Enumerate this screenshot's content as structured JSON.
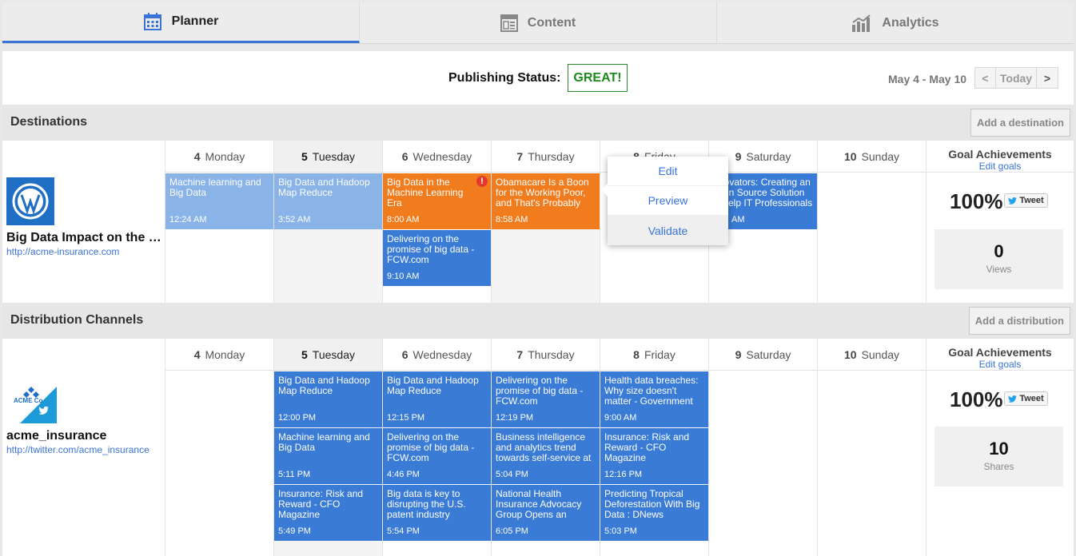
{
  "tabs": [
    {
      "label": "Planner",
      "icon": "calendar-icon"
    },
    {
      "label": "Content",
      "icon": "content-icon"
    },
    {
      "label": "Analytics",
      "icon": "analytics-icon"
    }
  ],
  "status": {
    "label": "Publishing Status:",
    "value": "GREAT!"
  },
  "date_nav": {
    "range": "May 4 - May 10",
    "prev": "<",
    "today": "Today",
    "next": ">"
  },
  "days": [
    {
      "num": "4",
      "name": "Monday"
    },
    {
      "num": "5",
      "name": "Tuesday"
    },
    {
      "num": "6",
      "name": "Wednesday"
    },
    {
      "num": "7",
      "name": "Thursday"
    },
    {
      "num": "8",
      "name": "Friday"
    },
    {
      "num": "9",
      "name": "Saturday"
    },
    {
      "num": "10",
      "name": "Sunday"
    }
  ],
  "goal": {
    "title": "Goal Achievements",
    "edit": "Edit goals"
  },
  "destinations": {
    "title": "Destinations",
    "add_label": "Add a destination",
    "name": "Big Data Impact on the In...",
    "url": "http://acme-insurance.com",
    "percent": "100%",
    "tweet": "Tweet",
    "metric_value": "0",
    "metric_label": "Views",
    "cards": [
      {
        "title": "Machine learning and Big Data",
        "time": "12:24 AM"
      },
      {
        "title": "Big Data and Hadoop Map Reduce",
        "time": "3:52 AM"
      },
      {
        "title": "Big Data in the Machine Learning Era",
        "time": "8:00 AM",
        "alert": "!"
      },
      {
        "title": "Delivering on the promise of big data - FCW.com",
        "time": "9:10 AM"
      },
      {
        "title": "Obamacare Is a Boon for the Working Poor, and That's Probably Good f...",
        "time": "8:58 AM"
      },
      {
        "title": "Innovators: Creating an Open Source Solution to Help IT Professionals ....",
        "time": "AM"
      }
    ]
  },
  "popup": {
    "edit": "Edit",
    "preview": "Preview",
    "validate": "Validate"
  },
  "distribution": {
    "title": "Distribution Channels",
    "add_label": "Add a distribution",
    "logo_text": "ACME Co",
    "name": "acme_insurance",
    "url": "http://twitter.com/acme_insurance",
    "percent": "100%",
    "tweet": "Tweet",
    "metric_value": "10",
    "metric_label": "Shares",
    "cards": [
      {
        "title": "Big Data and Hadoop Map Reduce",
        "time": "12:00 PM"
      },
      {
        "title": "Machine learning and Big Data",
        "time": "5:11 PM"
      },
      {
        "title": "Insurance: Risk and Reward - CFO Magazine",
        "time": "5:49 PM"
      },
      {
        "title": "Big Data and Hadoop Map Reduce",
        "time": "12:15 PM"
      },
      {
        "title": "Delivering on the promise of big data - FCW.com",
        "time": "4:46 PM"
      },
      {
        "title": "Big data is key to disrupting the U.S. patent industry",
        "time": "5:54 PM"
      },
      {
        "title": "Delivering on the promise of big data - FCW.com",
        "time": "12:19 PM"
      },
      {
        "title": "Business intelligence and analytics trend towards self-service at the Gartn...",
        "time": "5:04 PM"
      },
      {
        "title": "National Health Insurance Advocacy Group Opens an Innovation Lab in th...",
        "time": "6:05 PM"
      },
      {
        "title": "Health data breaches: Why size doesn't matter - Government Health IT",
        "time": "9:00 AM"
      },
      {
        "title": "Insurance: Risk and Reward - CFO Magazine",
        "time": "12:16 PM"
      },
      {
        "title": "Predicting Tropical Deforestation With Big Data : DNews",
        "time": "5:03 PM"
      }
    ]
  }
}
